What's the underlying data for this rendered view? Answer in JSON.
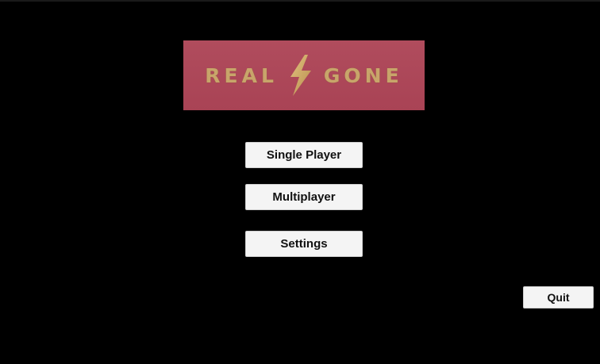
{
  "logo": {
    "word_left": "REAL",
    "word_right": "GONE",
    "icon": "lightning-bolt-icon",
    "background_color": "#ad4759",
    "text_color": "#c8a56a"
  },
  "menu": {
    "single_player_label": "Single Player",
    "multiplayer_label": "Multiplayer",
    "settings_label": "Settings",
    "quit_label": "Quit"
  },
  "colors": {
    "background": "#000000",
    "button_background": "#f4f4f4",
    "button_text": "#111111"
  }
}
